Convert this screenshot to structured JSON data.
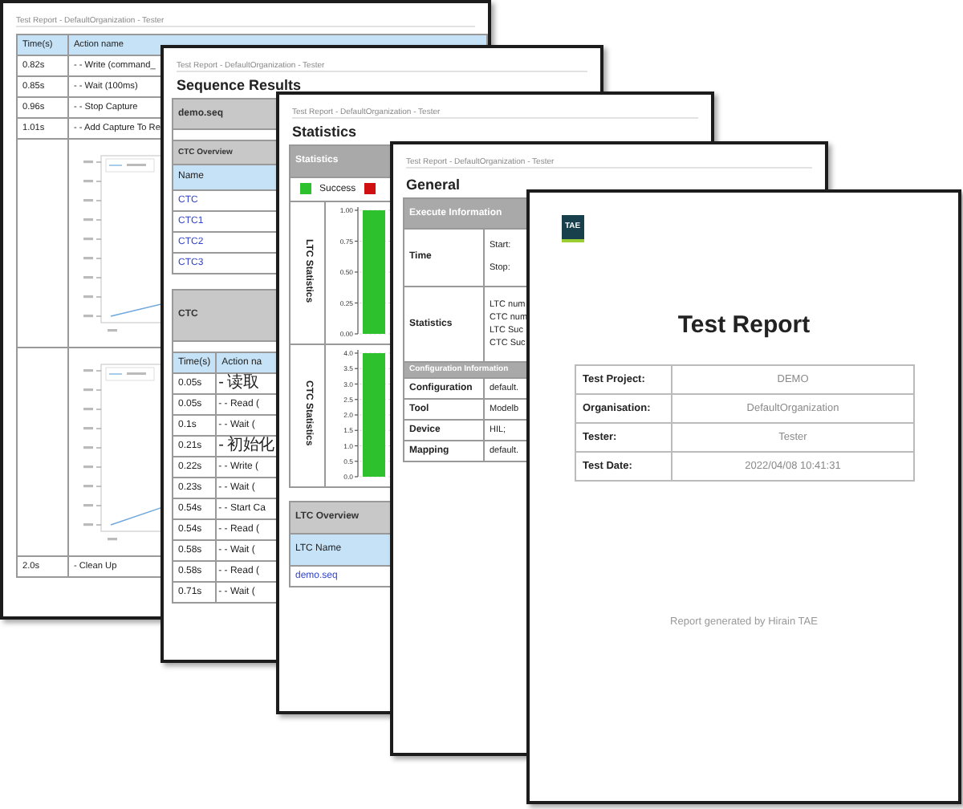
{
  "pages": [
    {
      "kind": "actions",
      "header": "Test Report - DefaultOrganization - Tester",
      "columns": [
        "Time(s)",
        "Action name"
      ],
      "rows": [
        {
          "kind": "step",
          "time": "0.82s",
          "action": "- - Write (command_"
        },
        {
          "kind": "step",
          "time": "0.85s",
          "action": "- - Wait (100ms)"
        },
        {
          "kind": "step",
          "time": "0.96s",
          "action": "- - Stop Capture"
        },
        {
          "kind": "step",
          "time": "1.01s",
          "action": "- - Add Capture To Re"
        },
        {
          "kind": "chart"
        },
        {
          "kind": "chart"
        },
        {
          "kind": "step",
          "time": "2.0s",
          "action": "- Clean Up"
        }
      ]
    },
    {
      "kind": "sequence",
      "header": "Test Report - DefaultOrganization - Tester",
      "title": "Sequence Results",
      "sequence": "demo.seq",
      "overview_title": "CTC Overview",
      "overview_column": "Name",
      "ctcs": [
        "CTC",
        "CTC1",
        "CTC2",
        "CTC3"
      ],
      "ctc_title": "CTC",
      "columns": [
        "Time(s)",
        "Action na"
      ],
      "rows": [
        {
          "time": "0.05s",
          "action": "- 读取"
        },
        {
          "time": "0.05s",
          "action": "- - Read ("
        },
        {
          "time": "0.1s",
          "action": "- - Wait ("
        },
        {
          "time": "0.21s",
          "action": "- 初始化"
        },
        {
          "time": "0.22s",
          "action": "- - Write ("
        },
        {
          "time": "0.23s",
          "action": "- - Wait ("
        },
        {
          "time": "0.54s",
          "action": "- - Start Ca"
        },
        {
          "time": "0.54s",
          "action": "- - Read ("
        },
        {
          "time": "0.58s",
          "action": "- - Wait ("
        },
        {
          "time": "0.58s",
          "action": "- - Read ("
        },
        {
          "time": "0.71s",
          "action": "- - Wait ("
        }
      ]
    },
    {
      "kind": "statistics",
      "header": "Test Report - DefaultOrganization - Tester",
      "title": "Statistics",
      "bar_title": "Statistics",
      "legend": [
        {
          "label": "Success",
          "color": "#2dc22d"
        },
        {
          "color": "#d01010"
        }
      ],
      "charts": [
        {
          "chart_data": {
            "type": "bar",
            "ylabel": "LTC Statistics",
            "grid": true,
            "series": [
              {
                "color": "#2dc22d",
                "values": [
                  1
                ]
              }
            ],
            "ylim": [
              0,
              1
            ],
            "yticks": [
              {
                "value": 0,
                "label": "0.00"
              },
              {
                "value": 0.25,
                "label": "0.25"
              },
              {
                "value": 0.5,
                "label": "0.50"
              },
              {
                "value": 0.75,
                "label": "0.75"
              },
              {
                "value": 1,
                "label": "1.00"
              }
            ]
          }
        },
        {
          "chart_data": {
            "type": "bar",
            "ylabel": "CTC Statistics",
            "grid": true,
            "series": [
              {
                "color": "#2dc22d",
                "values": [
                  4
                ]
              }
            ],
            "ylim": [
              0,
              4
            ],
            "yticks": [
              {
                "value": 0,
                "label": "0.0"
              },
              {
                "value": 0.5,
                "label": "0.5"
              },
              {
                "value": 1,
                "label": "1.0"
              },
              {
                "value": 1.5,
                "label": "1.5"
              },
              {
                "value": 2,
                "label": "2.0"
              },
              {
                "value": 2.5,
                "label": "2.5"
              },
              {
                "value": 3,
                "label": "3.0"
              },
              {
                "value": 3.5,
                "label": "3.5"
              },
              {
                "value": 4,
                "label": "4.0"
              }
            ]
          }
        }
      ],
      "overview_title": "LTC Overview",
      "overview_column": "LTC Name",
      "ltcs": [
        "demo.seq"
      ]
    },
    {
      "kind": "general",
      "header": "Test Report - DefaultOrganization - Tester",
      "title": "General",
      "execute_title": "Execute Information",
      "time_label": "Time",
      "time_lines": [
        "Start:",
        "Stop:"
      ],
      "stats_label": "Statistics",
      "stats_lines": [
        "LTC num",
        "CTC num",
        "LTC Suc",
        "CTC Suc"
      ],
      "config_title": "Configuration Information",
      "config": [
        {
          "label": "Configuration",
          "value": "default."
        },
        {
          "label": "Tool",
          "value": "Modelb"
        },
        {
          "label": "Device",
          "value": "HIL;"
        },
        {
          "label": "Mapping",
          "value": "default."
        }
      ]
    },
    {
      "kind": "cover",
      "logo": "TAE",
      "title": "Test Report",
      "fields": [
        {
          "label": "Test Project:",
          "value": "DEMO"
        },
        {
          "label": "Organisation:",
          "value": "DefaultOrganization"
        },
        {
          "label": "Tester:",
          "value": "Tester"
        },
        {
          "label": "Test Date:",
          "value": "2022/04/08 10:41:31"
        }
      ],
      "footer": "Report generated by Hirain TAE"
    }
  ]
}
